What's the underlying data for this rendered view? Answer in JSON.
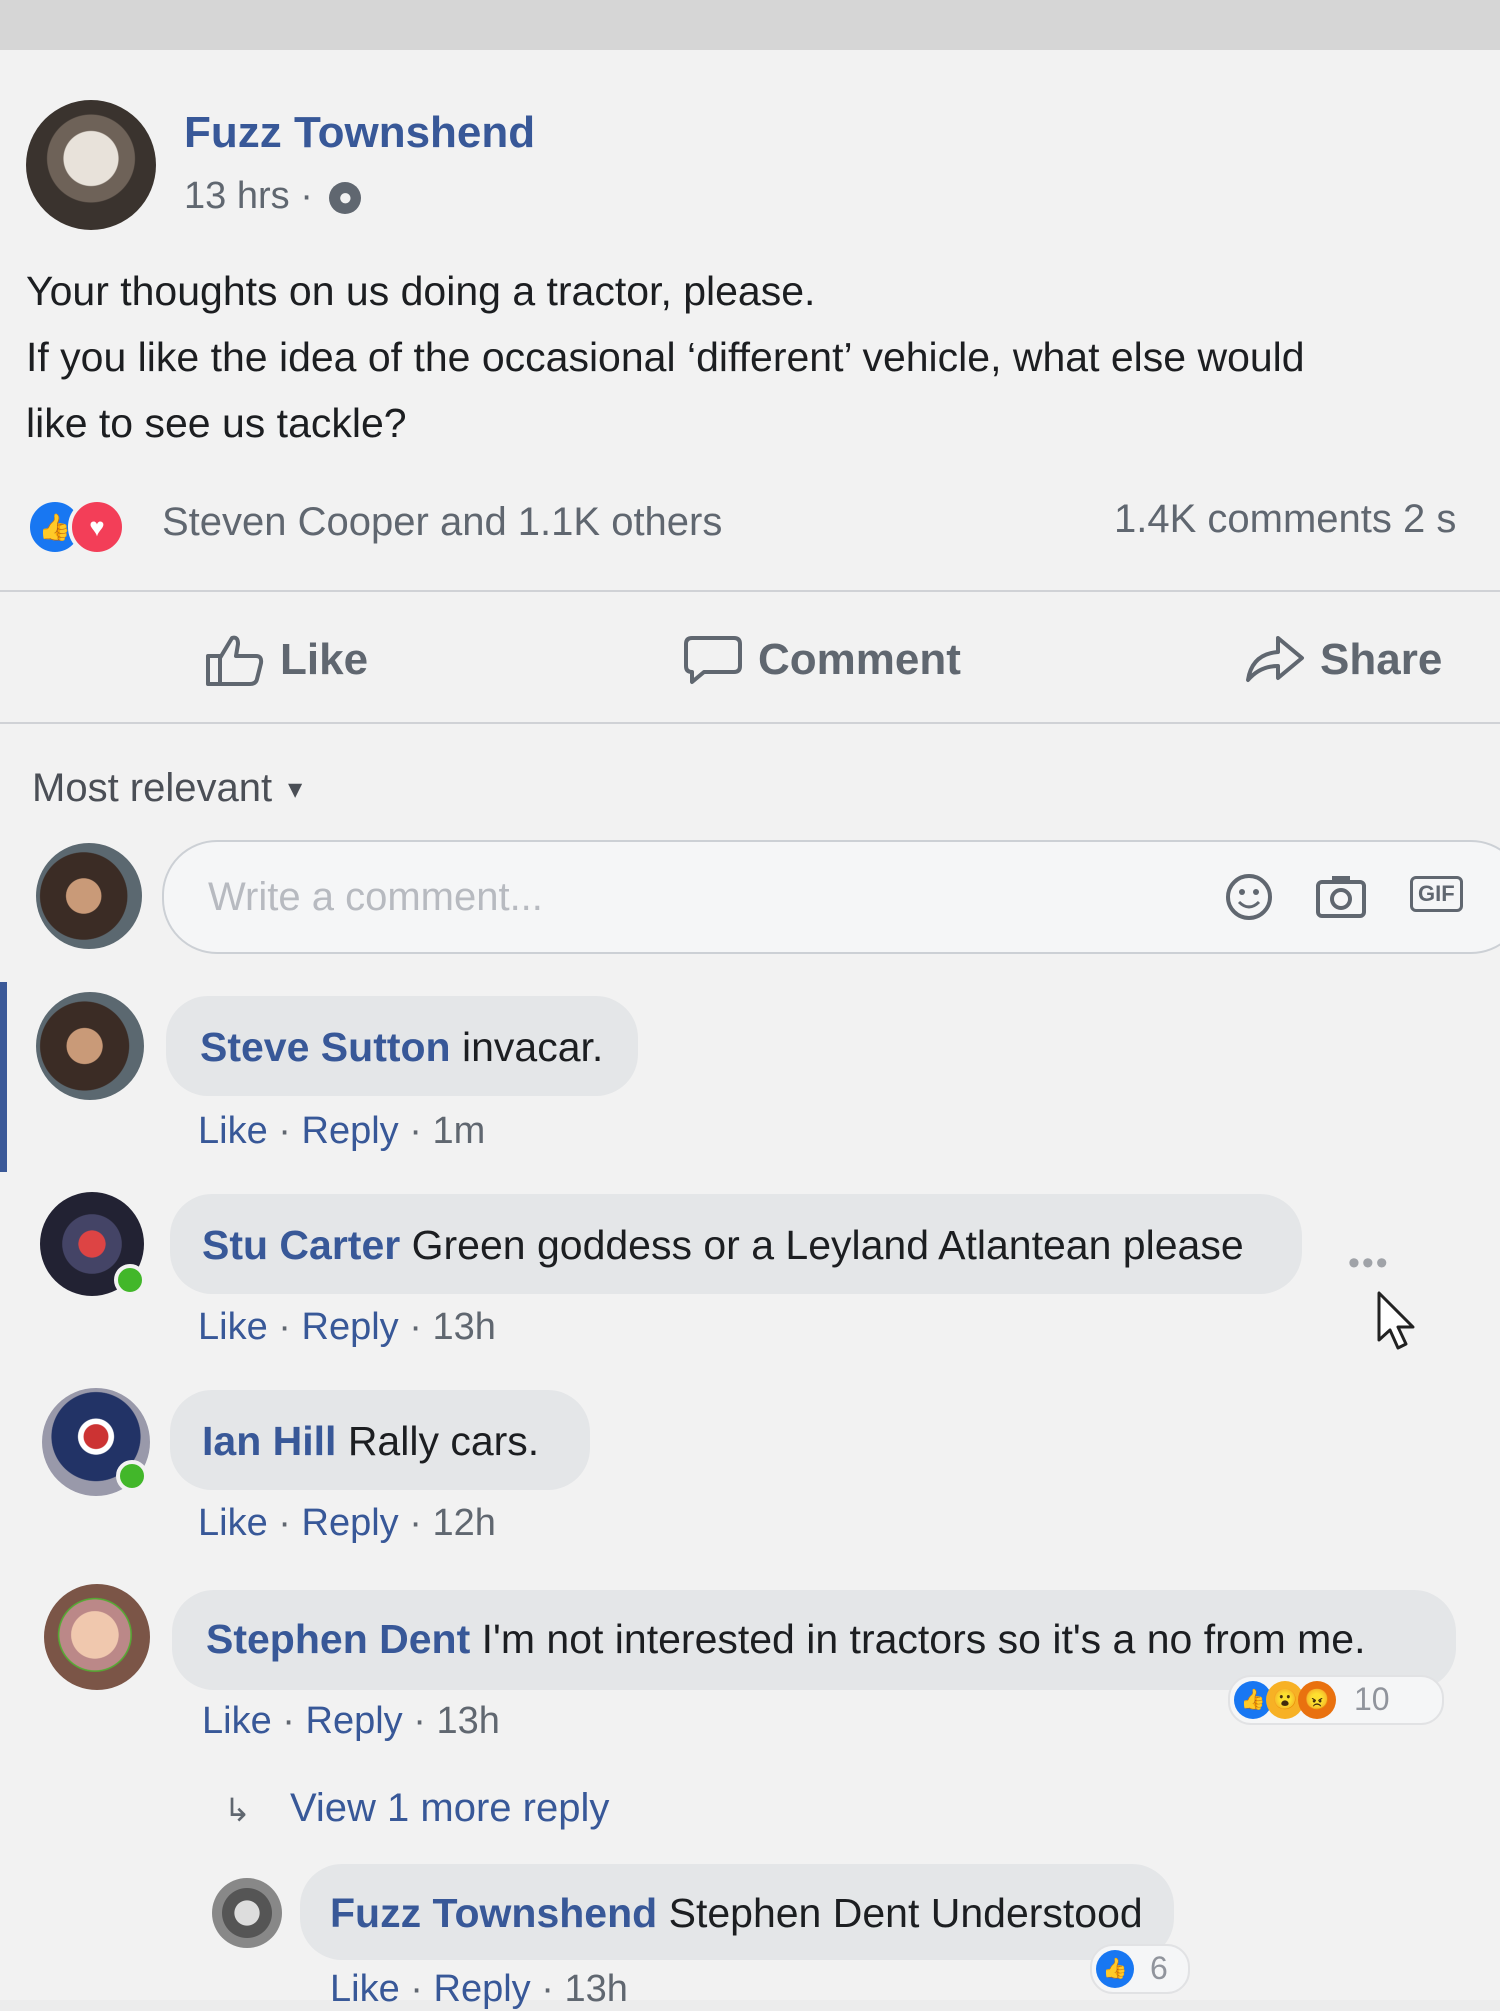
{
  "post": {
    "author": "Fuzz Townshend",
    "time": "13 hrs",
    "lines": [
      "Your thoughts on us doing a tractor, please.",
      "If you like the idea of the occasional ‘different’ vehicle, what else would",
      "like to see us tackle?"
    ],
    "reactors": "Steven Cooper and 1.1K others",
    "counts": "1.4K comments  2 s"
  },
  "actions": {
    "like": "Like",
    "comment": "Comment",
    "share": "Share"
  },
  "sort": {
    "label": "Most relevant"
  },
  "composer": {
    "placeholder": "Write a comment...",
    "gif": "GIF"
  },
  "comments": [
    {
      "name": "Steve Sutton",
      "text": "invacar.",
      "like": "Like",
      "reply": "Reply",
      "time": "1m"
    },
    {
      "name": "Stu Carter",
      "text": "Green goddess or a Leyland Atlantean please",
      "like": "Like",
      "reply": "Reply",
      "time": "13h"
    },
    {
      "name": "Ian Hill",
      "text": "Rally cars.",
      "like": "Like",
      "reply": "Reply",
      "time": "12h"
    },
    {
      "name": "Stephen Dent",
      "text": "I'm not interested in tractors so it's a no from me.",
      "like": "Like",
      "reply": "Reply",
      "time": "13h",
      "reaction_count": "10"
    }
  ],
  "more_replies": "View 1 more reply",
  "reply": {
    "name": "Fuzz Townshend",
    "text": "Stephen Dent Understood",
    "like": "Like",
    "reply": "Reply",
    "time": "13h",
    "reaction_count": "6"
  },
  "colors": {
    "link": "#385898",
    "like_blue": "#1877f2",
    "love_red": "#f33e58",
    "online": "#42b72a"
  }
}
